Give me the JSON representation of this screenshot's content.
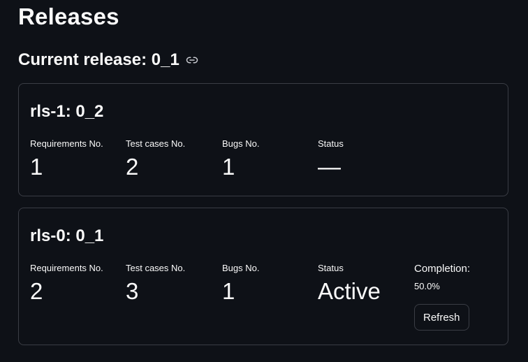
{
  "page": {
    "title": "Releases"
  },
  "current_release": {
    "heading": "Current release: 0_1",
    "link_icon": "link-icon"
  },
  "releases": [
    {
      "title": "rls-1: 0_2",
      "metrics": [
        {
          "label": "Requirements No.",
          "value": "1"
        },
        {
          "label": "Test cases No.",
          "value": "2"
        },
        {
          "label": "Bugs No.",
          "value": "1"
        },
        {
          "label": "Status",
          "value": "—"
        }
      ]
    },
    {
      "title": "rls-0: 0_1",
      "metrics": [
        {
          "label": "Requirements No.",
          "value": "2"
        },
        {
          "label": "Test cases No.",
          "value": "3"
        },
        {
          "label": "Bugs No.",
          "value": "1"
        },
        {
          "label": "Status",
          "value": "Active"
        }
      ],
      "completion_label": "Completion:",
      "completion_value": "50.0%",
      "refresh_label": "Refresh"
    }
  ],
  "colors": {
    "background": "#0e1117",
    "text": "#fafafa",
    "border": "#3a3d45"
  }
}
